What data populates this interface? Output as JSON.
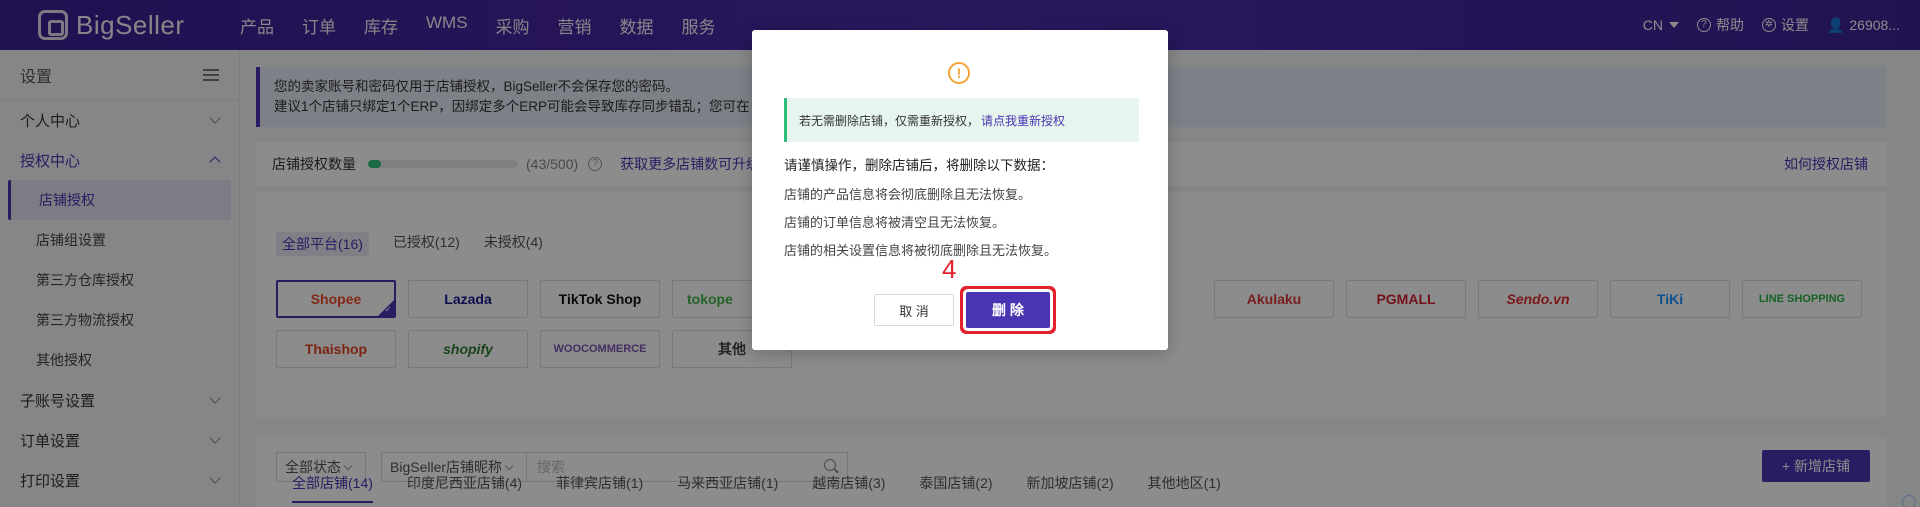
{
  "topnav": {
    "logo_text": "BigSeller",
    "items": [
      "产品",
      "订单",
      "库存",
      "WMS",
      "采购",
      "营销",
      "数据",
      "服务"
    ],
    "lang": "CN",
    "help": "帮助",
    "settings": "设置",
    "user": "26908..."
  },
  "sidebar": {
    "title": "设置",
    "groups": [
      {
        "label": "个人中心"
      },
      {
        "label": "授权中心",
        "subs": [
          "店铺授权",
          "店铺组设置",
          "第三方仓库授权",
          "第三方物流授权",
          "其他授权"
        ]
      },
      {
        "label": "子账号设置"
      },
      {
        "label": "订单设置"
      },
      {
        "label": "打印设置"
      }
    ]
  },
  "notice": {
    "line1": "您的卖家账号和密码仅用于店铺授权，BigSeller不会保存您的密码。",
    "line2": "建议1个店铺只绑定1个ERP，因绑定多个ERP可能会导致库存同步错乱；您可在"
  },
  "quota": {
    "label": "店铺授权数量",
    "count": "(43/500)",
    "fill_percent": 8.6,
    "more_link": "获取更多店铺数可升级",
    "help_link": "如何授权店铺"
  },
  "platform_tabs": [
    "全部平台(16)",
    "已授权(12)",
    "未授权(4)"
  ],
  "platforms": [
    "Shopee",
    "Lazada",
    "TikTok Shop",
    "tokope",
    "Akulaku",
    "PGMALL",
    "Sendo.vn",
    "TiKi",
    "LINE SHOPPING",
    "Thaishop",
    "shopify",
    "WOOCOMMERCE",
    "其他"
  ],
  "store_filters": {
    "status": "全部状态",
    "nickname": "BigSeller店铺昵称",
    "search_placeholder": "搜索",
    "add_button": "+ 新增店铺"
  },
  "store_tabs": [
    "全部店铺(14)",
    "印度尼西亚店铺(4)",
    "菲律宾店铺(1)",
    "马来西亚店铺(1)",
    "越南店铺(3)",
    "泰国店铺(2)",
    "新加坡店铺(2)",
    "其他地区(1)"
  ],
  "dialog": {
    "icon": "!",
    "tip_text": "若无需删除店铺，仅需重新授权，",
    "tip_link": "请点我重新授权",
    "heading": "请谨慎操作，删除店铺后，将删除以下数据：",
    "lines": [
      "店铺的产品信息将会彻底删除且无法恢复。",
      "店铺的订单信息将被清空且无法恢复。",
      "店铺的相关设置信息将被彻底删除且无法恢复。"
    ],
    "cancel": "取 消",
    "confirm": "删 除",
    "step": "4"
  },
  "colors": {
    "brand": "#4b34b2",
    "success": "#2fbf7a",
    "warning": "#f3a33b",
    "highlight": "#e3212b"
  }
}
